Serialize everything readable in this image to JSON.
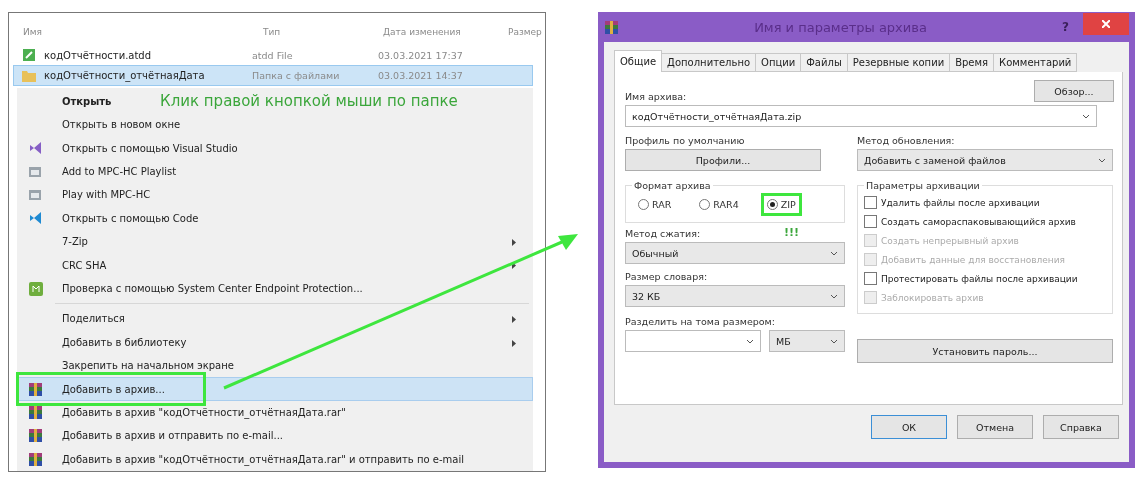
{
  "explorer": {
    "columns": [
      "Имя",
      "Тип",
      "Дата изменения",
      "Размер"
    ],
    "files": [
      {
        "name": "кодОтчётности.atdd",
        "type": "atdd File",
        "date": "03.03.2021 17:37",
        "kind": "file",
        "selected": false
      },
      {
        "name": "кодОтчётности_отчётнаяДата",
        "type": "Папка с файлами",
        "date": "03.03.2021 14:37",
        "kind": "folder",
        "selected": true
      }
    ]
  },
  "context_menu": {
    "groups": [
      [
        {
          "label": "Открыть",
          "kind": "plain",
          "bold": true,
          "submenu": false,
          "selected": false,
          "highlight": false
        },
        {
          "label": "Открыть в новом окне",
          "kind": "plain",
          "bold": false,
          "submenu": false,
          "selected": false,
          "highlight": false
        },
        {
          "label": "Открыть с помощью Visual Studio",
          "kind": "vs",
          "bold": false,
          "submenu": false,
          "selected": false,
          "highlight": false
        },
        {
          "label": "Add to MPC-HC Playlist",
          "kind": "mpc",
          "bold": false,
          "submenu": false,
          "selected": false,
          "highlight": false
        },
        {
          "label": "Play with MPC-HC",
          "kind": "mpc",
          "bold": false,
          "submenu": false,
          "selected": false,
          "highlight": false
        },
        {
          "label": "Открыть с помощью Code",
          "kind": "vscode",
          "bold": false,
          "submenu": false,
          "selected": false,
          "highlight": false
        },
        {
          "label": "7-Zip",
          "kind": "plain",
          "bold": false,
          "submenu": true,
          "selected": false,
          "highlight": false
        },
        {
          "label": "CRC SHA",
          "kind": "plain",
          "bold": false,
          "submenu": true,
          "selected": false,
          "highlight": false
        },
        {
          "label": "Проверка с помощью System Center Endpoint Protection...",
          "kind": "scep",
          "bold": false,
          "submenu": false,
          "selected": false,
          "highlight": false
        }
      ],
      [
        {
          "label": "Поделиться",
          "kind": "plain",
          "bold": false,
          "submenu": true,
          "selected": false,
          "highlight": false
        },
        {
          "label": "Добавить в библиотеку",
          "kind": "plain",
          "bold": false,
          "submenu": true,
          "selected": false,
          "highlight": false
        },
        {
          "label": "Закрепить на начальном экране",
          "kind": "plain",
          "bold": false,
          "submenu": false,
          "selected": false,
          "highlight": false
        },
        {
          "label": "Добавить в архив...",
          "kind": "winrar",
          "bold": false,
          "submenu": false,
          "selected": true,
          "highlight": true
        },
        {
          "label": "Добавить в архив \"кодОтчётности_отчётнаяДата.rar\"",
          "kind": "winrar",
          "bold": false,
          "submenu": false,
          "selected": false,
          "highlight": false
        },
        {
          "label": "Добавить в архив и отправить по e-mail...",
          "kind": "winrar",
          "bold": false,
          "submenu": false,
          "selected": false,
          "highlight": false
        },
        {
          "label": "Добавить в архив \"кодОтчётности_отчётнаяДата.rar\" и отправить по e-mail",
          "kind": "winrar",
          "bold": false,
          "submenu": false,
          "selected": false,
          "highlight": false
        }
      ]
    ]
  },
  "annotation": "Клик правой кнопкой мыши по папке",
  "dialog": {
    "title": "Имя и параметры архива",
    "help_glyph": "?",
    "tabs": [
      {
        "label": "Общие",
        "selected": true
      },
      {
        "label": "Дополнительно",
        "selected": false
      },
      {
        "label": "Опции",
        "selected": false
      },
      {
        "label": "Файлы",
        "selected": false
      },
      {
        "label": "Резервные копии",
        "selected": false
      },
      {
        "label": "Время",
        "selected": false
      },
      {
        "label": "Комментарий",
        "selected": false
      }
    ],
    "archive_name": {
      "label": "Имя архива:",
      "value": "кодОтчётности_отчётнаяДата.zip"
    },
    "browse_button": "Обзор...",
    "profile": {
      "label": "Профиль по умолчанию",
      "button": "Профили..."
    },
    "update_method": {
      "label": "Метод обновления:",
      "value": "Добавить с заменой файлов"
    },
    "format": {
      "legend": "Формат архива",
      "options": [
        {
          "label": "RAR",
          "selected": false,
          "highlight": false
        },
        {
          "label": "RAR4",
          "selected": false,
          "highlight": false
        },
        {
          "label": "ZIP",
          "selected": true,
          "highlight": true
        }
      ]
    },
    "compression": {
      "label": "Метод сжатия:",
      "value": "Обычный",
      "note": "!!!"
    },
    "dictionary": {
      "label": "Размер словаря:",
      "value": "32 КБ"
    },
    "split": {
      "label": "Разделить на тома размером:",
      "unit": "МБ"
    },
    "options": {
      "legend": "Параметры архивации",
      "items": [
        {
          "label": "Удалить файлы после архивации",
          "checked": false,
          "disabled": false
        },
        {
          "label": "Создать самораспаковывающийся архив",
          "checked": false,
          "disabled": false
        },
        {
          "label": "Создать непрерывный архив",
          "checked": false,
          "disabled": true
        },
        {
          "label": "Добавить данные для восстановления",
          "checked": false,
          "disabled": true
        },
        {
          "label": "Протестировать файлы после архивации",
          "checked": false,
          "disabled": false
        },
        {
          "label": "Заблокировать архив",
          "checked": false,
          "disabled": true
        }
      ]
    },
    "password_button": "Установить пароль...",
    "buttons": [
      {
        "label": "ОК",
        "default": true
      },
      {
        "label": "Отмена",
        "default": false
      },
      {
        "label": "Справка",
        "default": false
      }
    ]
  }
}
